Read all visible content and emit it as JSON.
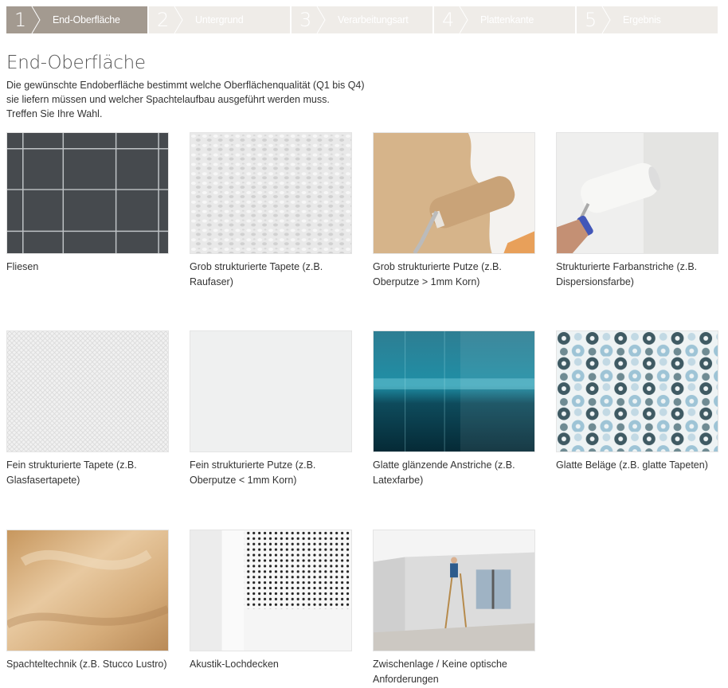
{
  "steps": [
    {
      "number": "1",
      "label": "End-Oberfläche",
      "active": true
    },
    {
      "number": "2",
      "label": "Untergrund",
      "active": false
    },
    {
      "number": "3",
      "label": "Verarbeitungsart",
      "active": false
    },
    {
      "number": "4",
      "label": "Plattenkante",
      "active": false
    },
    {
      "number": "5",
      "label": "Ergebnis",
      "active": false
    }
  ],
  "page": {
    "title": "End-Oberfläche",
    "description": [
      "Die gewünschte Endoberfläche bestimmt welche Oberflächenqualität (Q1 bis Q4)",
      "sie liefern müssen und welcher Spachtelaufbau ausgeführt werden muss.",
      "Treffen Sie Ihre Wahl."
    ]
  },
  "options": [
    {
      "label": "Fliesen",
      "image": "dark-tile-wall"
    },
    {
      "label": "Grob strukturierte Tapete (z.B. Raufaser)",
      "image": "woodchip-wallpaper"
    },
    {
      "label": "Grob strukturierte Putze (z.B. Oberputze > 1mm Korn)",
      "image": "roller-beige-plaster"
    },
    {
      "label": "Strukturierte Farbanstriche (z.B. Dispersionsfarbe)",
      "image": "roller-white-paint"
    },
    {
      "label": "Fein strukturierte Tapete (z.B. Glasfasertapete)",
      "image": "fiberglass-wallpaper"
    },
    {
      "label": "Fein strukturierte Putze (z.B. Oberputze < 1mm Korn)",
      "image": "smooth-white-plaster"
    },
    {
      "label": "Glatte glänzende Anstriche (z.B. Latexfarbe)",
      "image": "glossy-teal-wall"
    },
    {
      "label": "Glatte Beläge (z.B. glatte Tapeten)",
      "image": "flower-pattern-wallpaper"
    },
    {
      "label": "Spachteltechnik (z.B. Stucco Lustro)",
      "image": "stucco-lustro-surface"
    },
    {
      "label": "Akustik-Lochdecken",
      "image": "perforated-acoustic-ceiling"
    },
    {
      "label": "Zwischenlage / Keine optische Anforderungen",
      "image": "drywall-construction-room"
    }
  ],
  "colors": {
    "step_active_bg": "#a39a90",
    "step_inactive_bg": "#efece8",
    "text": "#333333"
  }
}
